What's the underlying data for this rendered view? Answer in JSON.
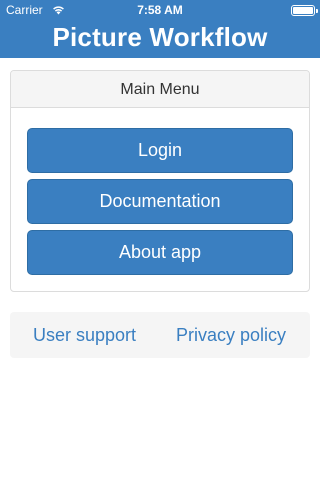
{
  "status_bar": {
    "carrier": "Carrier",
    "time": "7:58 AM",
    "wifi_icon": "wifi-icon",
    "battery_icon": "battery-icon"
  },
  "header": {
    "title": "Picture Workflow"
  },
  "main_menu": {
    "heading": "Main Menu",
    "buttons": {
      "login": "Login",
      "documentation": "Documentation",
      "about": "About app"
    }
  },
  "footer": {
    "user_support": "User support",
    "privacy_policy": "Privacy policy"
  },
  "colors": {
    "accent": "#3a7fc1",
    "panel_border": "#dcdcdc",
    "panel_heading_bg": "#f5f5f5"
  }
}
